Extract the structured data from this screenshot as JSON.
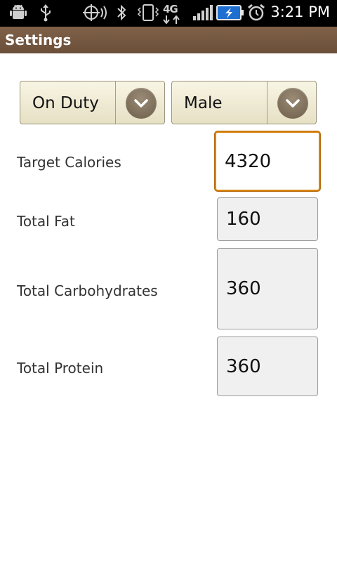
{
  "status_bar": {
    "time": "3:21 PM",
    "network_label": "4G"
  },
  "title_bar": {
    "title": "Settings"
  },
  "spinners": {
    "duty": {
      "selected": "On Duty"
    },
    "gender": {
      "selected": "Male"
    }
  },
  "fields": [
    {
      "label": "Target Calories",
      "value": "4320"
    },
    {
      "label": "Total Fat",
      "value": "160"
    },
    {
      "label": "Total Carbohydrates",
      "value": "360"
    },
    {
      "label": "Total Protein",
      "value": "360"
    }
  ],
  "colors": {
    "title_bar": "#735640",
    "focus_border": "#d9820e",
    "status_bar": "#000000"
  }
}
